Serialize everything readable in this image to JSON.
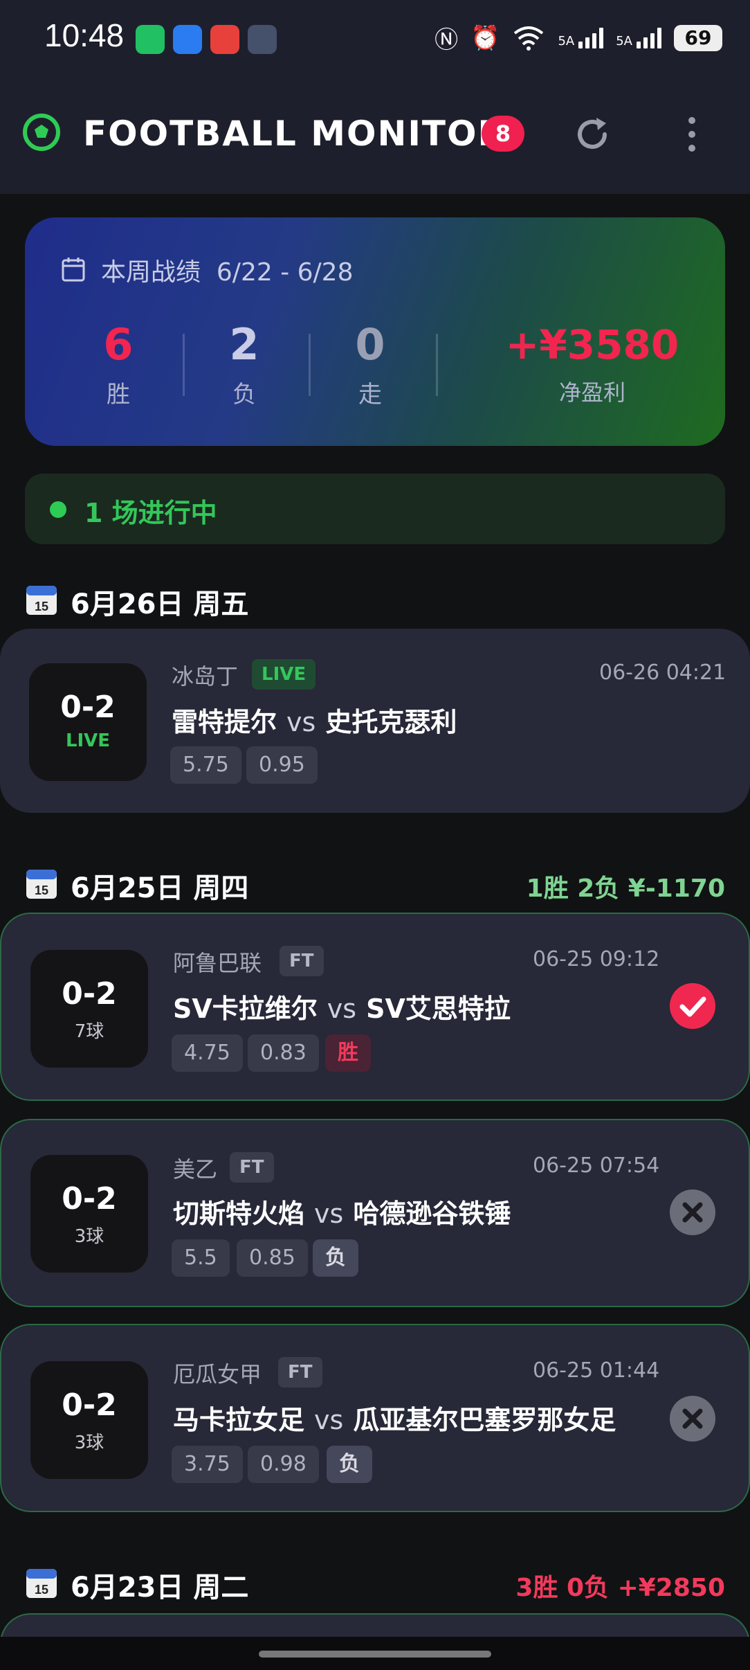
{
  "status_bar": {
    "time": "10:48",
    "net1": "5A",
    "net2": "5A",
    "battery": "69"
  },
  "app": {
    "title": "FOOTBALL MONITOR",
    "badge": "8",
    "accent": "#f02050"
  },
  "weekly": {
    "label": "本周战绩",
    "range": "6/22 - 6/28",
    "wins": "6",
    "wins_label": "胜",
    "losses": "2",
    "losses_label": "负",
    "draws": "0",
    "draws_label": "走",
    "profit": "+¥3580",
    "profit_label": "净盈利"
  },
  "live_banner": {
    "text": "1 场进行中"
  },
  "days": [
    {
      "title": "6月26日 周五",
      "summary": ""
    },
    {
      "title": "6月25日 周四",
      "summary": "1胜 2负  ¥-1170",
      "summary_color": "#7fd492"
    },
    {
      "title": "6月23日 周二",
      "summary": "3胜 0负  +¥2850",
      "summary_color": "#f23a5c"
    }
  ],
  "matches": [
    {
      "score": "0-2",
      "sub": "LIVE",
      "league": "冰岛丁",
      "status": "LIVE",
      "time": "06-26 04:21",
      "home": "雷特提尔",
      "vs": "vs",
      "away": "史托克瑟利",
      "odd1": "5.75",
      "odd2": "0.95",
      "result": ""
    },
    {
      "score": "0-2",
      "sub": "7球",
      "league": "阿鲁巴联",
      "status": "FT",
      "time": "06-25 09:12",
      "home": "SV卡拉维尔",
      "vs": "vs",
      "away": "SV艾思特拉",
      "odd1": "4.75",
      "odd2": "0.83",
      "result": "胜"
    },
    {
      "score": "0-2",
      "sub": "3球",
      "league": "美乙",
      "status": "FT",
      "time": "06-25 07:54",
      "home": "切斯特火焰",
      "vs": "vs",
      "away": "哈德逊谷铁锤",
      "odd1": "5.5",
      "odd2": "0.85",
      "result": "负"
    },
    {
      "score": "0-2",
      "sub": "3球",
      "league": "厄瓜女甲",
      "status": "FT",
      "time": "06-25 01:44",
      "home": "马卡拉女足",
      "vs": "vs",
      "away": "瓜亚基尔巴塞罗那女足",
      "odd1": "3.75",
      "odd2": "0.98",
      "result": "负"
    }
  ]
}
